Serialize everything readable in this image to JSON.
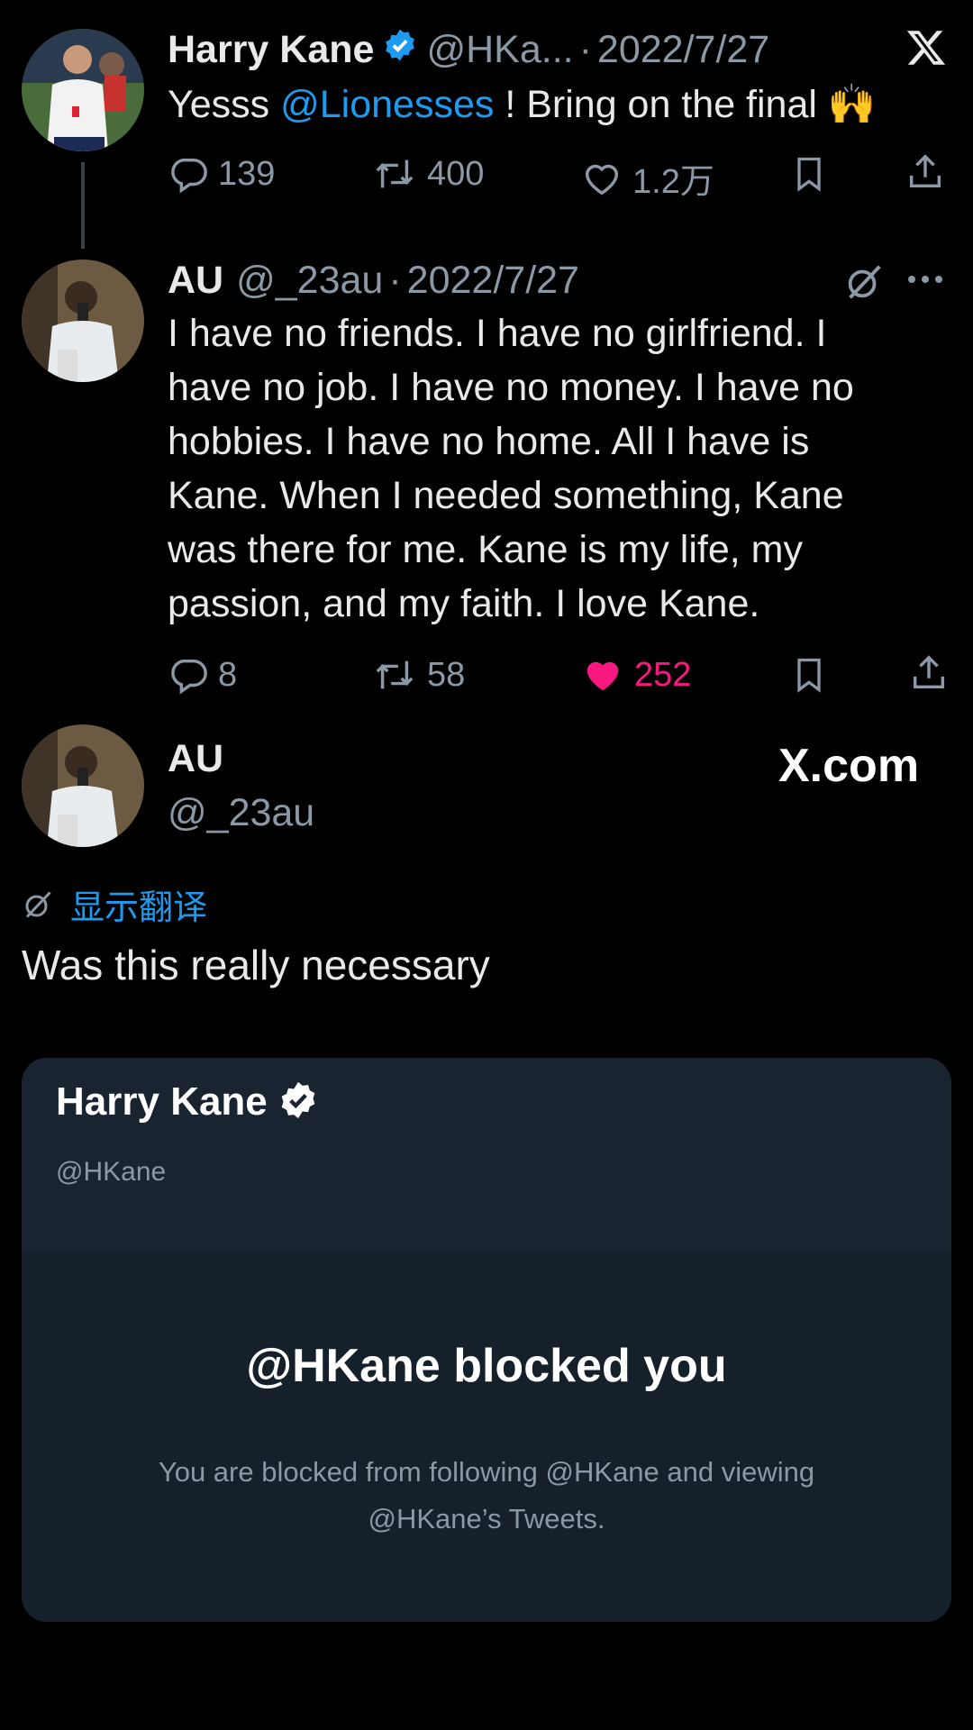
{
  "tweet1": {
    "display_name": "Harry Kane",
    "handle": "@HKa...",
    "separator": "·",
    "date": "2022/7/27",
    "text_before": "Yesss ",
    "mention": "@Lionesses",
    "text_after": " ! Bring on the final ",
    "emoji": "🙌",
    "replies": "139",
    "retweets": "400",
    "likes": "1.2万"
  },
  "tweet2": {
    "display_name": "AU",
    "handle": "@_23au",
    "separator": "·",
    "date": "2022/7/27",
    "text": "I have no friends. I have no girlfriend. I have no job. I have no money. I have no hobbies. I have no home. All I have is Kane. When I needed something, Kane was there for me. Kane is my life, my passion, and my faith. I love Kane.",
    "replies": "8",
    "retweets": "58",
    "likes": "252"
  },
  "post": {
    "display_name": "AU",
    "handle": "@_23au",
    "brand": "X.com",
    "translate_label": "显示翻译",
    "text": "Was this really necessary"
  },
  "embedded_card": {
    "display_name": "Harry Kane",
    "handle": "@HKane",
    "blocked_title": "@HKane blocked you",
    "blocked_body": "You are blocked from following @HKane and viewing @HKane’s Tweets."
  },
  "colors": {
    "background": "#000000",
    "text": "#e7e9ea",
    "secondary": "#8b98a5",
    "accent_blue": "#1d9bf0",
    "like_pink": "#f91880",
    "card_bg": "#15202b"
  }
}
